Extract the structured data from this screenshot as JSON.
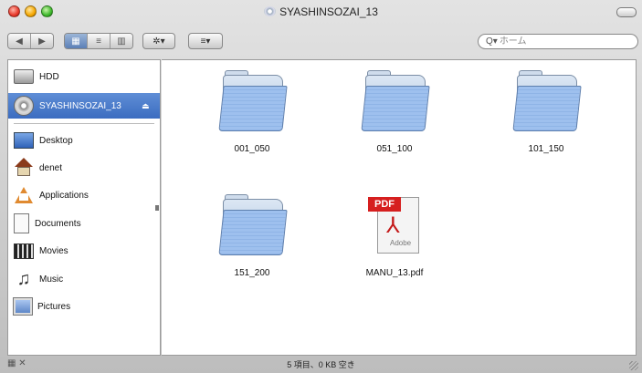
{
  "window": {
    "title": "SYASHINSOZAI_13"
  },
  "toolbar": {
    "nav_back": "◀",
    "nav_forward": "▶",
    "view_icon": "▦",
    "view_list": "≡",
    "view_column": "▥",
    "action_label": "✲▾",
    "arrange_label": "≡▾",
    "search": {
      "icon": "Q▾",
      "placeholder": "ホーム"
    }
  },
  "sidebar": {
    "devices": [
      {
        "label": "HDD",
        "icon": "hard-drive-icon"
      },
      {
        "label": "SYASHINSOZAI_13",
        "icon": "cd-disc-icon",
        "selected": true,
        "eject": "⏏"
      }
    ],
    "places": [
      {
        "label": "Desktop",
        "icon": "desktop-icon"
      },
      {
        "label": "denet",
        "icon": "home-icon"
      },
      {
        "label": "Applications",
        "icon": "applications-icon"
      },
      {
        "label": "Documents",
        "icon": "documents-icon"
      },
      {
        "label": "Movies",
        "icon": "movies-icon"
      },
      {
        "label": "Music",
        "icon": "music-icon"
      },
      {
        "label": "Pictures",
        "icon": "pictures-icon"
      }
    ]
  },
  "files": [
    {
      "name": "001_050",
      "kind": "folder"
    },
    {
      "name": "051_100",
      "kind": "folder"
    },
    {
      "name": "101_150",
      "kind": "folder"
    },
    {
      "name": "151_200",
      "kind": "folder"
    },
    {
      "name": "MANU_13.pdf",
      "kind": "pdf",
      "badge": "PDF",
      "brand": "Adobe"
    }
  ],
  "status": {
    "text": "5 項目、0 KB 空き",
    "left_icons": "▦ ✕"
  }
}
